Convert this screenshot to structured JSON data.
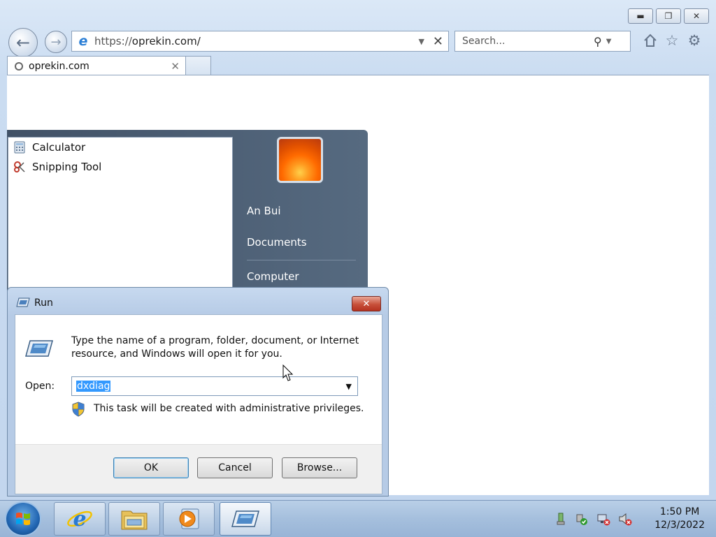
{
  "browser": {
    "url_protocol": "https://",
    "url_host": "oprekin.com/",
    "search_placeholder": "Search...",
    "tab_title": "oprekin.com"
  },
  "start_menu": {
    "programs": [
      {
        "label": "Calculator",
        "icon": "calculator-icon"
      },
      {
        "label": "Snipping Tool",
        "icon": "snipping-tool-icon"
      }
    ],
    "user_name": "An Bui",
    "documents": "Documents",
    "computer": "Computer"
  },
  "run_dialog": {
    "title": "Run",
    "description": "Type the name of a program, folder, document, or Internet resource, and Windows will open it for you.",
    "open_label": "Open:",
    "open_value": "dxdiag",
    "admin_note": "This task will be created with administrative privileges.",
    "ok_label": "OK",
    "cancel_label": "Cancel",
    "browse_label": "Browse..."
  },
  "taskbar": {
    "pinned": [
      "internet-explorer-icon",
      "windows-explorer-icon",
      "media-player-icon",
      "run-icon"
    ],
    "clock_time": "1:50 PM",
    "clock_date": "12/3/2022"
  }
}
